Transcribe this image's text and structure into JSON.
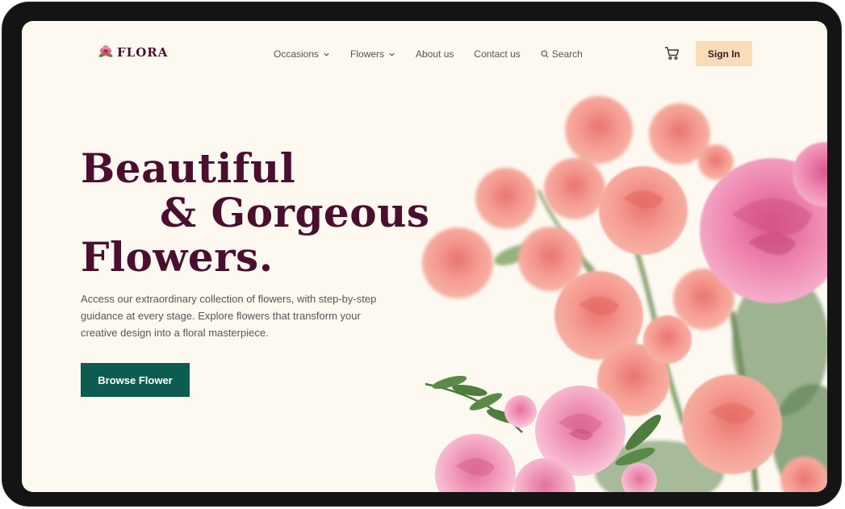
{
  "brand": {
    "name": "FLORA",
    "logo_icon": "flower-icon"
  },
  "nav": {
    "items": [
      {
        "label": "Occasions",
        "has_dropdown": true
      },
      {
        "label": "Flowers",
        "has_dropdown": true
      },
      {
        "label": "About us",
        "has_dropdown": false
      },
      {
        "label": "Contact us",
        "has_dropdown": false
      }
    ],
    "search_label": "Search"
  },
  "header": {
    "cart_icon": "cart-icon",
    "signin_label": "Sign In"
  },
  "hero": {
    "headline_line1": "Beautiful",
    "headline_line2": "& Gorgeous",
    "headline_line3": "Flowers.",
    "description": "Access our extraordinary collection of flowers, with step-by-step guidance at every stage. Explore flowers that transform your creative design into a floral masterpiece.",
    "cta_label": "Browse Flower"
  },
  "colors": {
    "background": "#fdf9f1",
    "headline": "#4a0f2f",
    "cta": "#0d5c4f",
    "signin": "#f9ddb8",
    "rose_peach": "#f49a92",
    "rose_pink": "#ec7fa8"
  }
}
